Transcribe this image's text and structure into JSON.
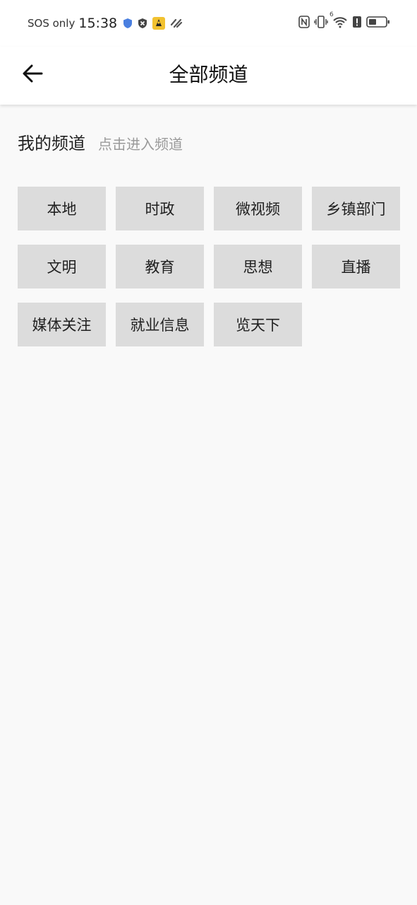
{
  "status_bar": {
    "carrier": "SOS only",
    "time": "15:38",
    "icons_left": [
      "shield-icon",
      "close-shield-icon",
      "app-notification-icon",
      "link-icon"
    ],
    "icons_right": [
      "nfc-icon",
      "vibrate-icon",
      "wifi-icon",
      "alert-icon",
      "battery-icon"
    ],
    "wifi_superscript": "6"
  },
  "header": {
    "title": "全部频道",
    "back_icon": "arrow-left-icon"
  },
  "my_channels": {
    "title": "我的频道",
    "hint": "点击进入频道",
    "items": [
      {
        "label": "本地"
      },
      {
        "label": "时政"
      },
      {
        "label": "微视频"
      },
      {
        "label": "乡镇部门"
      },
      {
        "label": "文明"
      },
      {
        "label": "教育"
      },
      {
        "label": "思想"
      },
      {
        "label": "直播"
      },
      {
        "label": "媒体关注"
      },
      {
        "label": "就业信息"
      },
      {
        "label": "览天下"
      }
    ]
  },
  "colors": {
    "background": "#f9f9f9",
    "chip": "#dcdcdc",
    "hint": "#9a9a9a"
  }
}
